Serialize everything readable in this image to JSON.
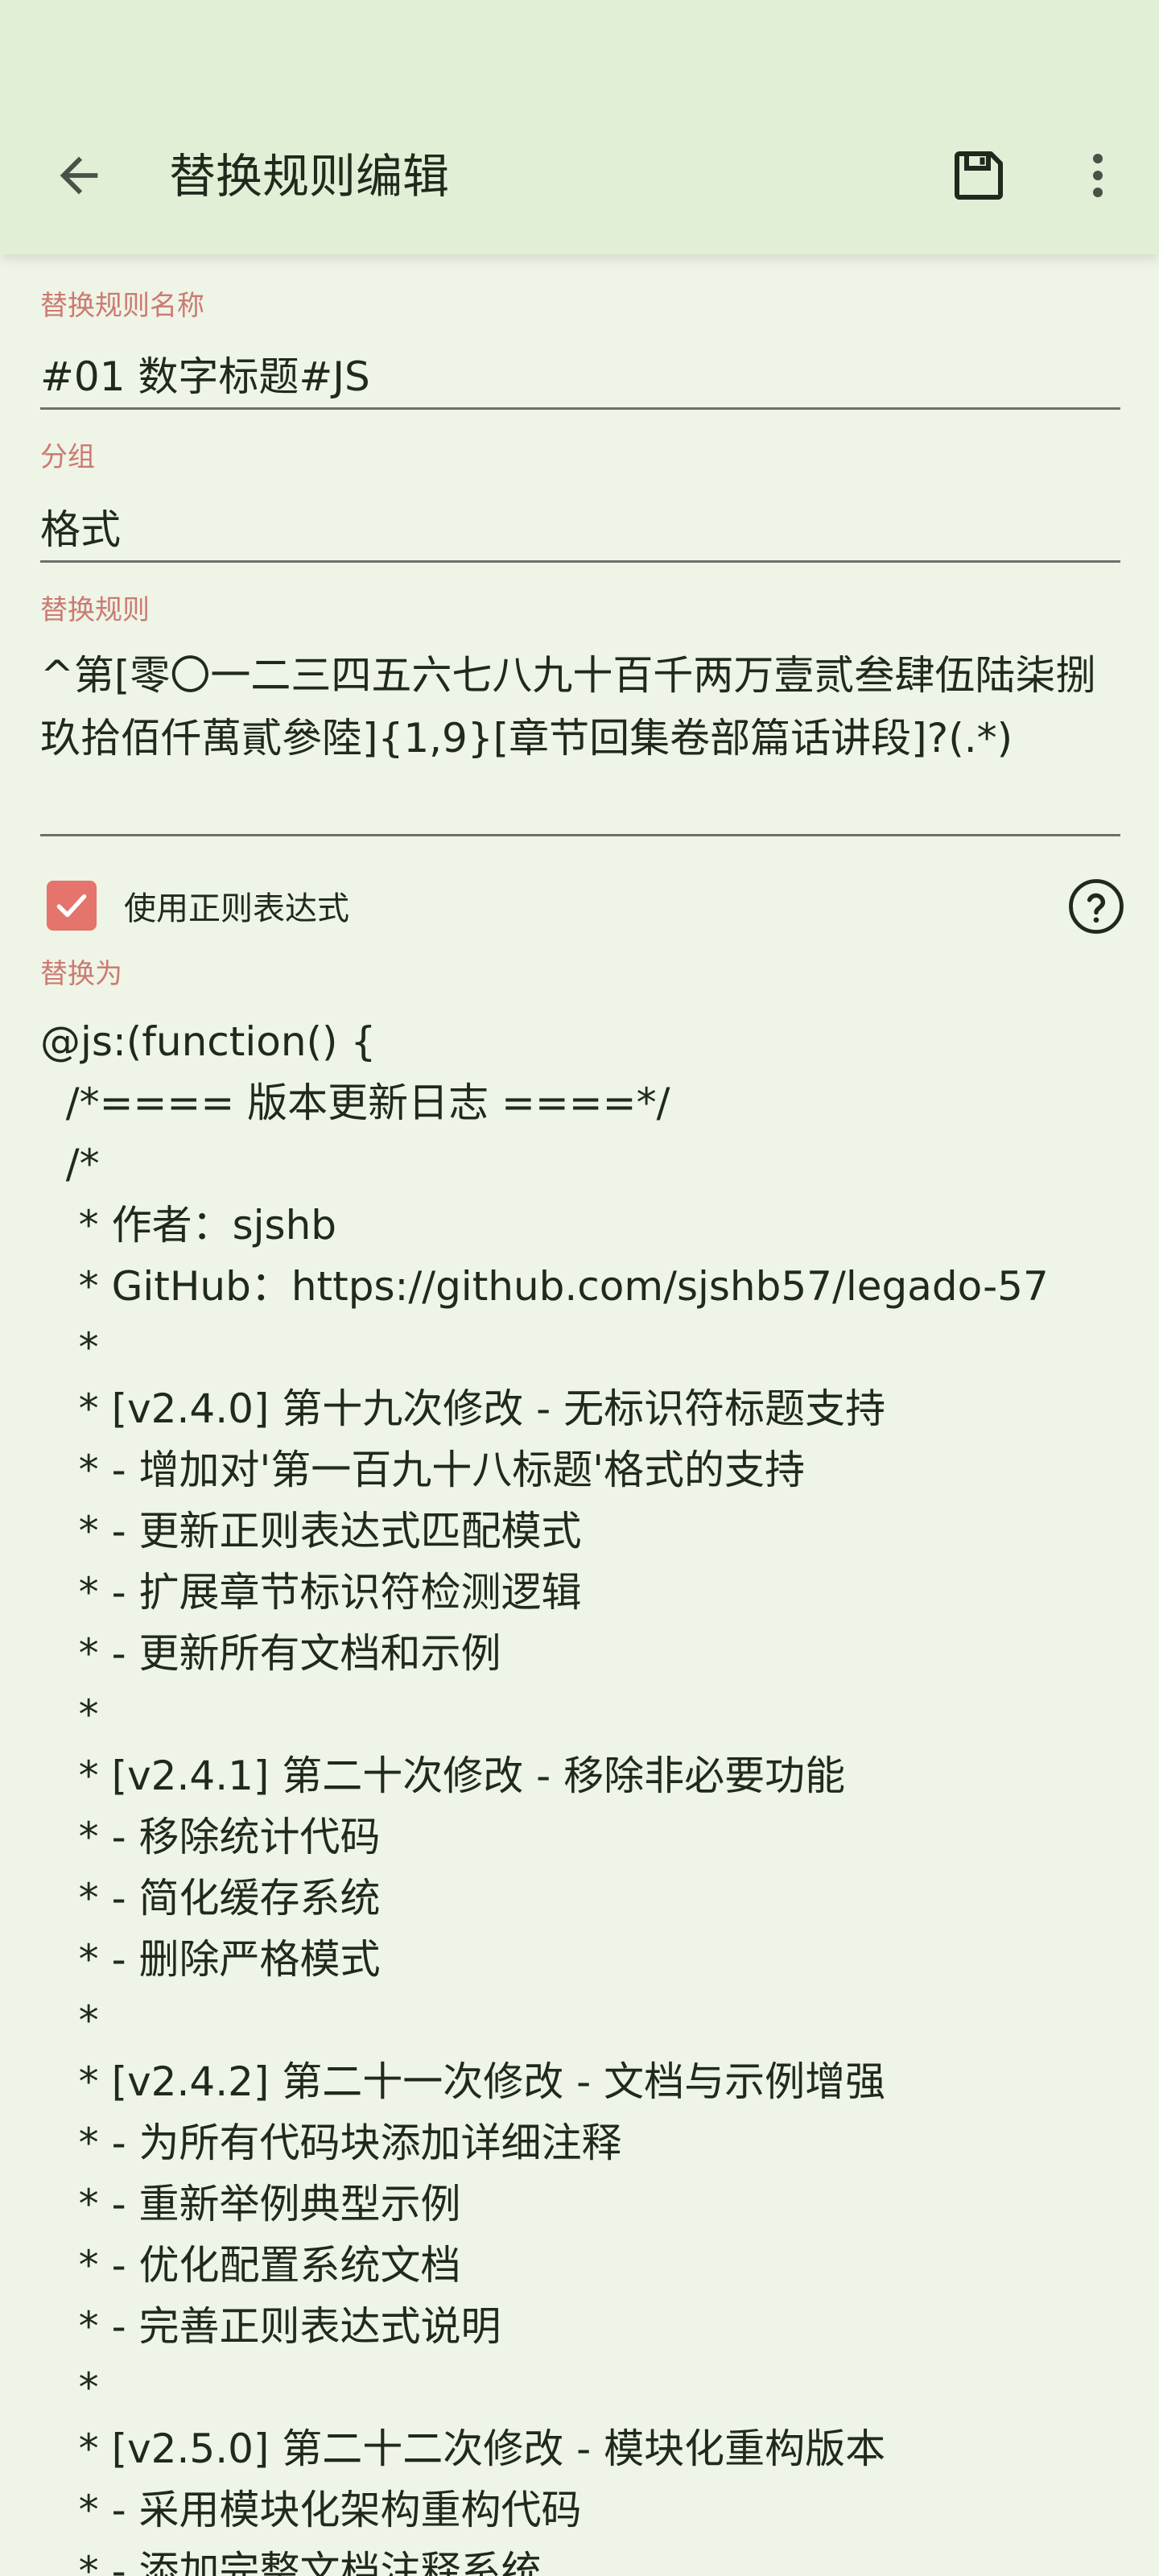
{
  "appbar": {
    "title": "替换规则编辑",
    "back_icon": "arrow-left-icon",
    "save_icon": "save-icon",
    "more_icon": "more-vert-icon"
  },
  "form": {
    "name_label": "替换规则名称",
    "name_value": "#01 数字标题#JS",
    "group_label": "分组",
    "group_value": "格式",
    "rule_label": "替换规则",
    "rule_value": "^第[零〇一二三四五六七八九十百千两万壹贰叁肆伍陆柒捌玖拾佰仟萬貳參陸]{1,9}[章节回集卷部篇话讲段]?(.*)",
    "use_regex_label": "使用正则表达式",
    "use_regex_checked": true,
    "replace_label": "替换为",
    "replace_lines": [
      "@js:(function() {",
      "  /*==== 版本更新日志 ====*/",
      "  /*",
      "   * 作者：sjshb",
      "   * GitHub：https://github.com/sjshb57/legado-57",
      "   *",
      "   * [v2.4.0] 第十九次修改 - 无标识符标题支持",
      "   * - 增加对'第一百九十八标题'格式的支持",
      "   * - 更新正则表达式匹配模式",
      "   * - 扩展章节标识符检测逻辑",
      "   * - 更新所有文档和示例",
      "   *",
      "   * [v2.4.1] 第二十次修改 - 移除非必要功能",
      "   * - 移除统计代码",
      "   * - 简化缓存系统",
      "   * - 删除严格模式",
      "   *",
      "   * [v2.4.2] 第二十一次修改 - 文档与示例增强",
      "   * - 为所有代码块添加详细注释",
      "   * - 重新举例典型示例",
      "   * - 优化配置系统文档",
      "   * - 完善正则表达式说明",
      "   *",
      "   * [v2.5.0] 第二十二次修改 - 模块化重构版本",
      "   * - 采用模块化架构重构代码",
      "   * - 添加完整文档注释系统"
    ]
  },
  "colors": {
    "background": "#eef4e6",
    "appbar": "#e2efd7",
    "label": "#cc7a72",
    "accent": "#e4746c",
    "text": "#1f2a1c"
  }
}
